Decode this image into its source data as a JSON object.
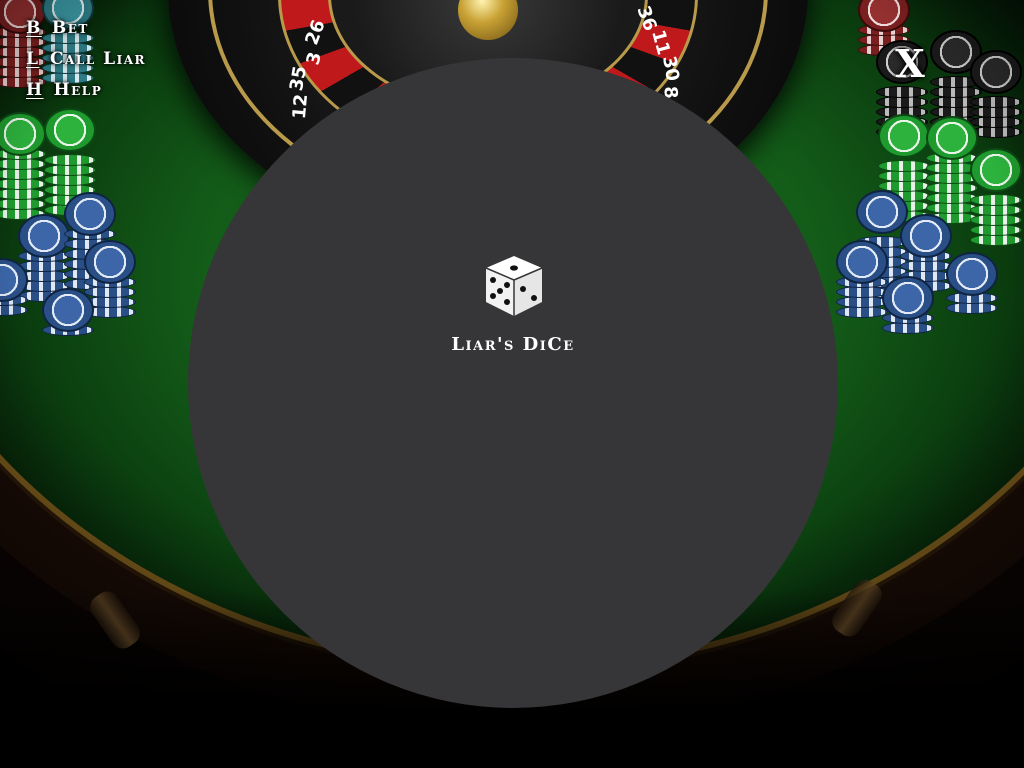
{
  "controls": [
    {
      "key": "B",
      "label": "Bet"
    },
    {
      "key": "L",
      "label": "Call Liar"
    },
    {
      "key": "H",
      "label": "Help"
    }
  ],
  "close": {
    "label": "X"
  },
  "center": {
    "icon": "dice-icon",
    "title": "Liar's DiCe"
  },
  "wheel": {
    "numbers": [
      "26",
      "3",
      "35",
      "12",
      "36",
      "11",
      "30",
      "8"
    ]
  },
  "colors": {
    "felt": "#1d7a22",
    "panel": "#363638",
    "text": "#ffffff",
    "gold": "#b89a4a"
  }
}
